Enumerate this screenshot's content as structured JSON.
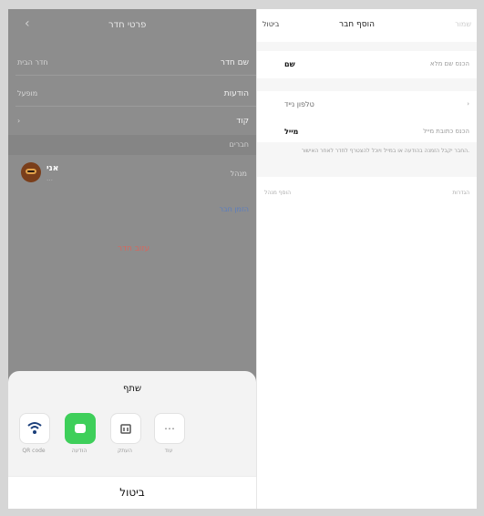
{
  "left": {
    "back_icon": "chevron-left-icon",
    "title": "פרטי חדר",
    "rows": [
      {
        "label": "שם חדר",
        "value": "חדר הבית"
      },
      {
        "label": "הודעות",
        "value": "מופעל"
      },
      {
        "label": "קוד",
        "value": "›"
      }
    ],
    "section": "חברים",
    "member": {
      "name": "אני",
      "sub": "…",
      "role": "מנהל"
    },
    "invite_link": "הזמן חבר",
    "leave": "עזוב חדר"
  },
  "share": {
    "title": "שתף",
    "tiles": [
      {
        "icon": "wifi-qr-icon",
        "label": "QR code"
      },
      {
        "icon": "messages-icon",
        "label": "הודעה"
      },
      {
        "icon": "copy-icon",
        "label": "העתק"
      },
      {
        "icon": "more-icon",
        "label": "עוד"
      }
    ],
    "cancel": "ביטול"
  },
  "right": {
    "header": {
      "left": "ביטול",
      "center": "הוסף חבר",
      "right": "שמור"
    },
    "rows": [
      {
        "label": "שם",
        "value": "הכנס שם מלא"
      },
      {
        "label": "טלפון נייד",
        "value": "›"
      },
      {
        "label": "מייל",
        "value": "הכנס כתובת מייל"
      }
    ],
    "note": "החבר יקבל הזמנה בהודעה או במייל ויוכל להצטרף לחדר לאחר האישור.",
    "footer_left": "הוסף מנהל",
    "footer_right": "הגדרות"
  }
}
